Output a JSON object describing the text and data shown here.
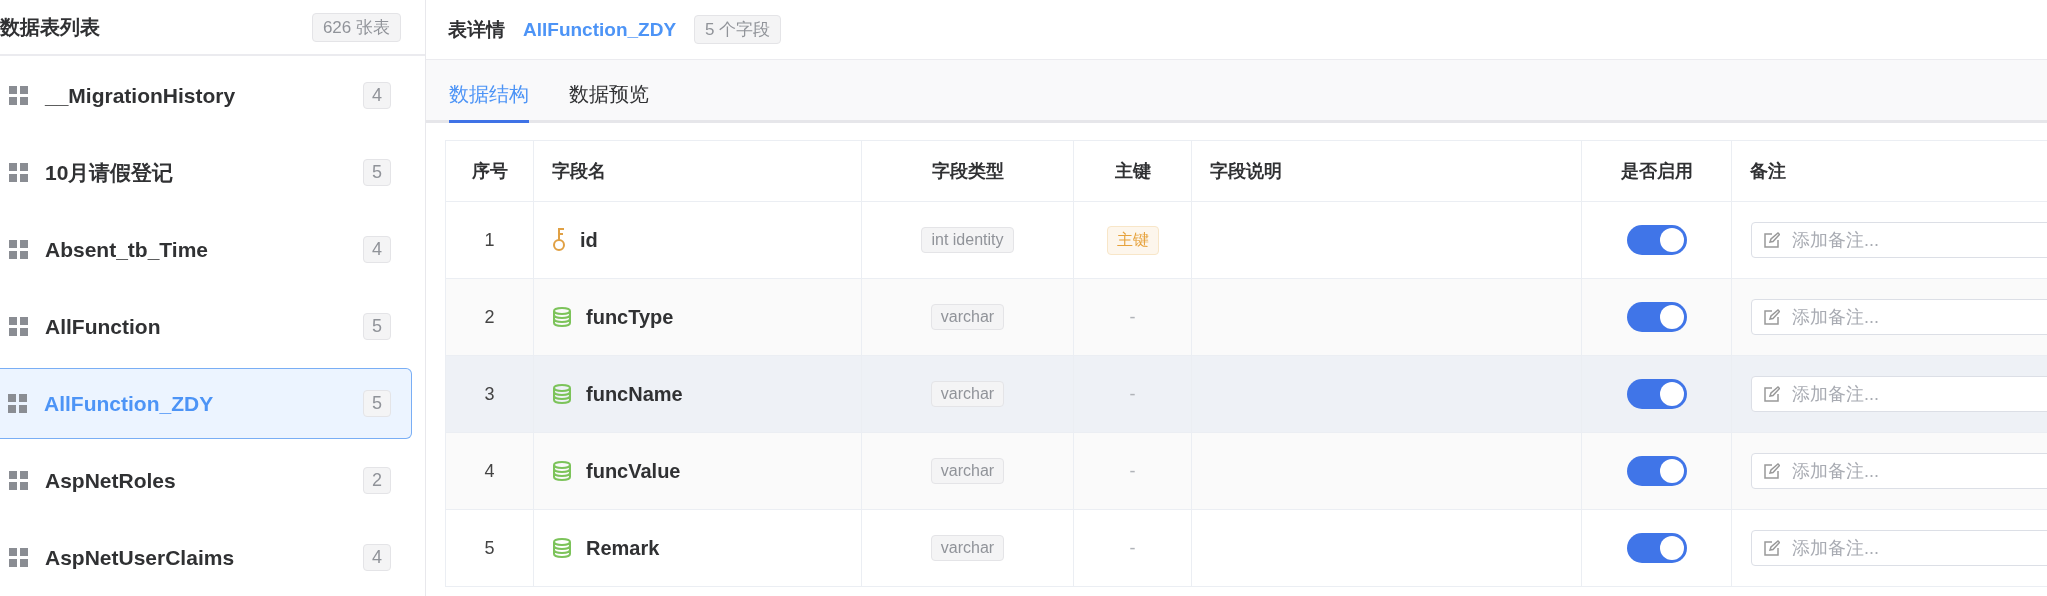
{
  "sidebar": {
    "title": "数据表列表",
    "count": "626 张表",
    "items": [
      {
        "name": "__MigrationHistory",
        "count": "4",
        "selected": false
      },
      {
        "name": "10月请假登记",
        "count": "5",
        "selected": false
      },
      {
        "name": "Absent_tb_Time",
        "count": "4",
        "selected": false
      },
      {
        "name": "AllFunction",
        "count": "5",
        "selected": false
      },
      {
        "name": "AllFunction_ZDY",
        "count": "5",
        "selected": true
      },
      {
        "name": "AspNetRoles",
        "count": "2",
        "selected": false
      },
      {
        "name": "AspNetUserClaims",
        "count": "4",
        "selected": false
      }
    ]
  },
  "detail": {
    "title": "表详情",
    "table_name": "AllFunction_ZDY",
    "field_count": "5 个字段"
  },
  "tabs": [
    {
      "label": "数据结构",
      "selected": true
    },
    {
      "label": "数据预览",
      "selected": false
    }
  ],
  "table": {
    "columns": [
      "序号",
      "字段名",
      "字段类型",
      "主键",
      "字段说明",
      "是否启用",
      "备注"
    ],
    "rows": [
      {
        "index": "1",
        "name": "id",
        "primary": true,
        "type": "int identity",
        "key": "主键",
        "enabled": true,
        "hovered": false,
        "remark_placeholder": "添加备注..."
      },
      {
        "index": "2",
        "name": "funcType",
        "primary": false,
        "type": "varchar",
        "key": "-",
        "enabled": true,
        "hovered": false,
        "remark_placeholder": "添加备注..."
      },
      {
        "index": "3",
        "name": "funcName",
        "primary": false,
        "type": "varchar",
        "key": "-",
        "enabled": true,
        "hovered": true,
        "remark_placeholder": "添加备注..."
      },
      {
        "index": "4",
        "name": "funcValue",
        "primary": false,
        "type": "varchar",
        "key": "-",
        "enabled": true,
        "hovered": false,
        "remark_placeholder": "添加备注..."
      },
      {
        "index": "5",
        "name": "Remark",
        "primary": false,
        "type": "varchar",
        "key": "-",
        "enabled": true,
        "hovered": false,
        "remark_placeholder": "添加备注..."
      }
    ]
  }
}
